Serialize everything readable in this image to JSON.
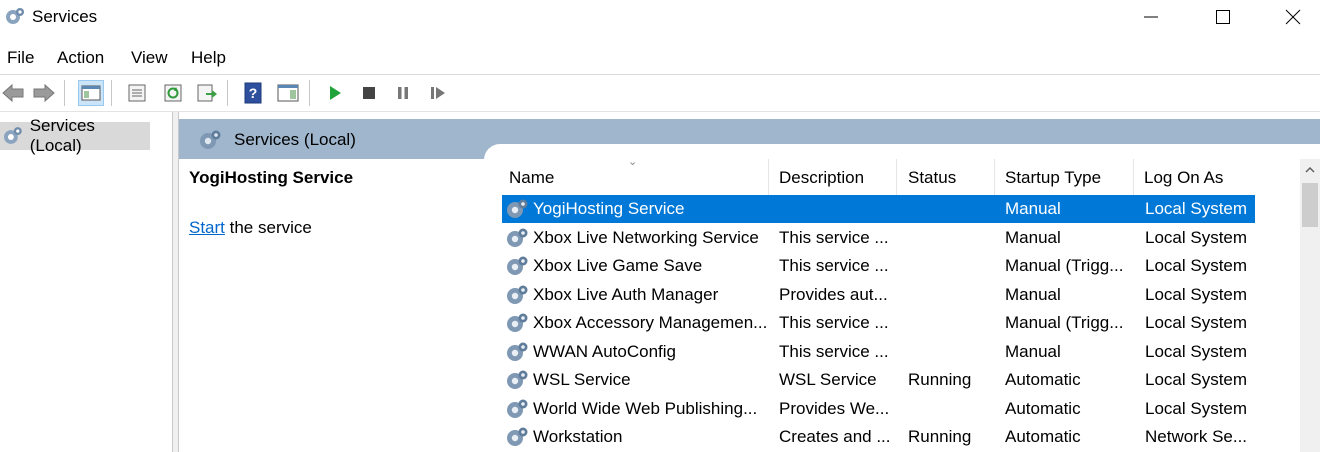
{
  "window": {
    "title": "Services",
    "icon": "gears-icon"
  },
  "menu": [
    "File",
    "Action",
    "View",
    "Help"
  ],
  "toolbar": {
    "buttons": [
      "back-icon",
      "forward-icon",
      "console-tree-icon",
      "properties-icon",
      "refresh-icon",
      "export-list-icon",
      "help-icon",
      "show-action-pane-icon",
      "start-service-icon",
      "stop-service-icon",
      "pause-service-icon",
      "resume-service-icon"
    ]
  },
  "tree": {
    "root_label": "Services (Local)"
  },
  "pane": {
    "title": "Services (Local)",
    "selected_service": "YogiHosting Service",
    "action_link": "Start",
    "action_rest": " the service"
  },
  "list": {
    "columns": [
      "Name",
      "Description",
      "Status",
      "Startup Type",
      "Log On As"
    ],
    "rows": [
      {
        "name": "YogiHosting Service",
        "description": "",
        "status": "",
        "startup": "Manual",
        "logon": "Local System",
        "selected": true
      },
      {
        "name": "Xbox Live Networking Service",
        "description": "This service ...",
        "status": "",
        "startup": "Manual",
        "logon": "Local System"
      },
      {
        "name": "Xbox Live Game Save",
        "description": "This service ...",
        "status": "",
        "startup": "Manual (Trigg...",
        "logon": "Local System"
      },
      {
        "name": "Xbox Live Auth Manager",
        "description": "Provides aut...",
        "status": "",
        "startup": "Manual",
        "logon": "Local System"
      },
      {
        "name": "Xbox Accessory Managemen...",
        "description": "This service ...",
        "status": "",
        "startup": "Manual (Trigg...",
        "logon": "Local System"
      },
      {
        "name": "WWAN AutoConfig",
        "description": "This service ...",
        "status": "",
        "startup": "Manual",
        "logon": "Local System"
      },
      {
        "name": "WSL Service",
        "description": "WSL Service",
        "status": "Running",
        "startup": "Automatic",
        "logon": "Local System"
      },
      {
        "name": "World Wide Web Publishing...",
        "description": "Provides We...",
        "status": "",
        "startup": "Automatic",
        "logon": "Local System"
      },
      {
        "name": "Workstation",
        "description": "Creates and ...",
        "status": "Running",
        "startup": "Automatic",
        "logon": "Network Se..."
      }
    ]
  },
  "colors": {
    "selection": "#0078d7",
    "header": "#9fb6cd",
    "link": "#0066cc",
    "start_green": "#1fa33a"
  }
}
